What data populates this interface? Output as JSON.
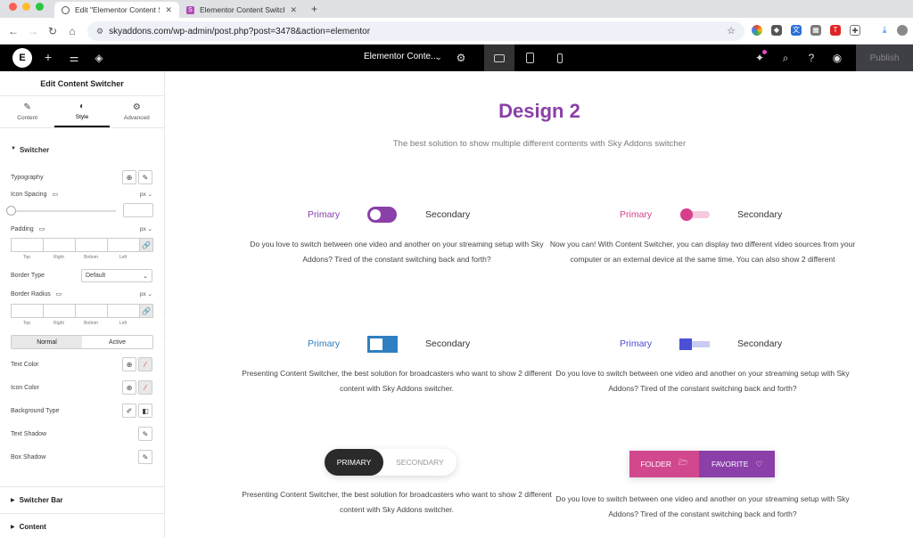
{
  "browser": {
    "tabs": [
      {
        "title": "Edit \"Elementor Content Swit",
        "active": true
      },
      {
        "title": "Elementor Content Switcher",
        "active": false
      }
    ],
    "url": "skyaddons.com/wp-admin/post.php?post=3478&action=elementor"
  },
  "topbar": {
    "document_title": "Elementor Conte...",
    "publish_label": "Publish"
  },
  "panel": {
    "title": "Edit Content Switcher",
    "tabs": [
      "Content",
      "Style",
      "Advanced"
    ],
    "section": "Switcher",
    "typography_label": "Typography",
    "icon_spacing_label": "Icon Spacing",
    "unit": "px",
    "padding_label": "Padding",
    "sides": [
      "Top",
      "Right",
      "Bottom",
      "Left"
    ],
    "border_type_label": "Border Type",
    "border_type_value": "Default",
    "border_radius_label": "Border Radius",
    "state_tabs": [
      "Normal",
      "Active"
    ],
    "text_color_label": "Text Color",
    "icon_color_label": "Icon Color",
    "background_type_label": "Background Type",
    "text_shadow_label": "Text Shadow",
    "box_shadow_label": "Box Shadow",
    "collapsed_sections": [
      "Switcher Bar",
      "Content"
    ]
  },
  "canvas": {
    "heading": "Design 2",
    "subheading": "The best solution to show multiple different contents with Sky Addons switcher",
    "switchers": [
      {
        "primary": "Primary",
        "secondary": "Secondary",
        "primary_color": "#8a3fa9",
        "text": "Do you love to switch between one video and another on your streaming setup with Sky Addons? Tired of the constant switching back and forth?"
      },
      {
        "primary": "Primary",
        "secondary": "Secondary",
        "primary_color": "#d63f8c",
        "text": "Now you can! With Content Switcher, you can display two different video sources from your computer or an external device at the same time. You can also show 2 different"
      },
      {
        "primary": "Primary",
        "secondary": "Secondary",
        "primary_color": "#2f7fc1",
        "text": "Presenting Content Switcher, the best solution for broadcasters who want to show 2 different content with Sky Addons switcher."
      },
      {
        "primary": "Primary",
        "secondary": "Secondary",
        "primary_color": "#4a4fd6",
        "text": "Do you love to switch between one video and another on your streaming setup with Sky Addons? Tired of the constant switching back and forth?"
      },
      {
        "primary": "PRIMARY",
        "secondary": "SECONDARY",
        "text": "Presenting Content Switcher, the best solution for broadcasters who want to show 2 different content with Sky Addons switcher."
      },
      {
        "primary": "FOLDER",
        "secondary": "FAVORITE",
        "text": "Do you love to switch between one video and another on your streaming setup with Sky Addons? Tired of the constant switching back and forth?"
      }
    ]
  },
  "colors": {
    "heading": "#8a3fa9",
    "topbar": "#000000"
  }
}
